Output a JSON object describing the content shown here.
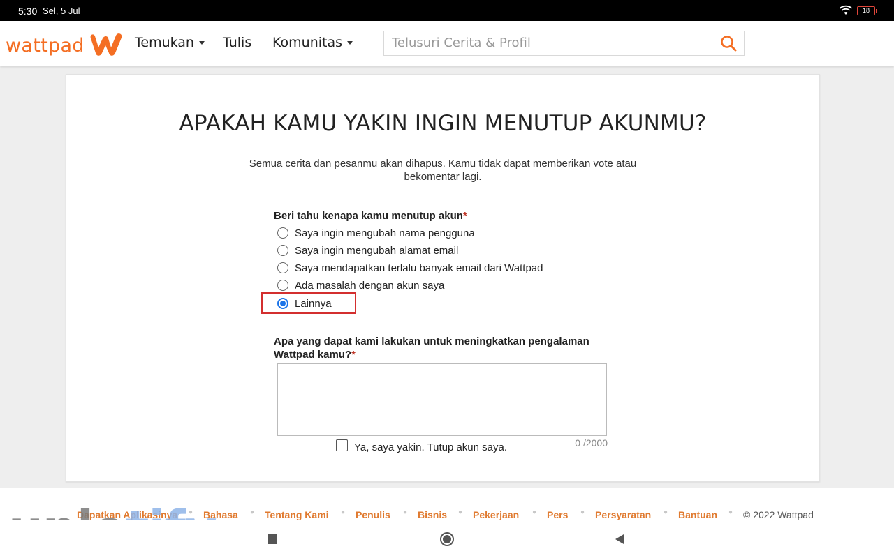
{
  "status_bar": {
    "time": "5:30",
    "date": "Sel, 5 Jul",
    "battery": "18",
    "battery_color": "#e0453a"
  },
  "header": {
    "logo_text": "wattpad",
    "brand_color": "#f46e23",
    "nav": {
      "discover": "Temukan",
      "write": "Tulis",
      "community": "Komunitas"
    },
    "search_placeholder": "Telusuri Cerita & Profil"
  },
  "main": {
    "title": "APAKAH KAMU YAKIN INGIN MENUTUP AKUNMU?",
    "description": "Semua cerita dan pesanmu akan dihapus. Kamu tidak dapat memberikan vote atau bekomentar lagi.",
    "reason_question": "Beri tahu kenapa kamu menutup akun",
    "required_mark": "*",
    "options": [
      "Saya ingin mengubah nama pengguna",
      "Saya ingin mengubah alamat email",
      "Saya mendapatkan terlalu banyak email dari Wattpad",
      "Ada masalah dengan akun saya",
      "Lainnya"
    ],
    "selected_option": "Lainnya",
    "highlight_color": "#d32f2f",
    "feedback_question": "Apa yang dapat kami lakukan untuk meningkatkan pengalaman Wattpad kamu?",
    "feedback_value": "",
    "char_counter": "0 /2000",
    "confirm_label": "Ya, saya yakin. Tutup akun saya.",
    "confirm_checked": false
  },
  "footer": {
    "links": [
      "Dapatkan Aplikasinya",
      "Bahasa",
      "Tentang Kami",
      "Penulis",
      "Bisnis",
      "Pekerjaan",
      "Pers",
      "Persyaratan",
      "Bantuan"
    ],
    "copyright": "© 2022 Wattpad",
    "link_color": "#e07a2f"
  },
  "watermark": {
    "part1": "uplo",
    "part2": "tify"
  },
  "android_nav": {
    "icons": [
      "recent-apps-icon",
      "home-icon",
      "back-icon"
    ]
  }
}
